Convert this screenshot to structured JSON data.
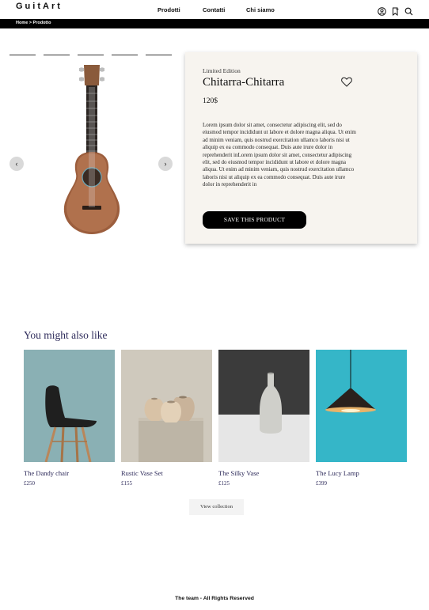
{
  "header": {
    "logo_text": "GuitArt",
    "nav": [
      "Prodotti",
      "Contatti",
      "Chi siamo"
    ],
    "icons": [
      "user-icon",
      "bookmark-icon",
      "search-icon"
    ]
  },
  "breadcrumb": {
    "text": "Home > Prodotto"
  },
  "product": {
    "edition": "Limited Edition",
    "title": "Chitarra-Chitarra",
    "price": "120$",
    "description": "Lorem ipsum dolor sit amet, consectetur adipiscing elit, sed do eiusmod tempor incididunt ut labore et dolore magna aliqua. Ut enim ad minim veniam, quis nostrud exercitation ullamco laboris nisi ut aliquip ex ea commodo consequat. Duis aute irure dolor in reprehenderit inLorem ipsum dolor sit amet, consectetur adipiscing elit, sed do eiusmod tempor incididunt ut labore et dolore magna aliqua. Ut enim ad minim veniam, quis nostrud exercitation ullamco laboris nisi ut aliquip ex ea commodo consequat. Duis aute irure dolor in reprehenderit in",
    "save_label": "SAVE THIS PRODUCT",
    "gallery_prev": "‹",
    "gallery_next": "›"
  },
  "suggestions": {
    "heading": "You might also like",
    "items": [
      {
        "name": "The Dandy chair",
        "price": "£250"
      },
      {
        "name": "Rustic Vase Set",
        "price": "£155"
      },
      {
        "name": "The Silky Vase",
        "price": "£125"
      },
      {
        "name": "The Lucy Lamp",
        "price": "£399"
      }
    ],
    "view_label": "View collection"
  },
  "footer": {
    "text": "The team - All Rights Reserved"
  },
  "colors": {
    "accent_text": "#2d2a5a",
    "card_bg": "#f7f4ef",
    "bar_bg": "#000000"
  }
}
